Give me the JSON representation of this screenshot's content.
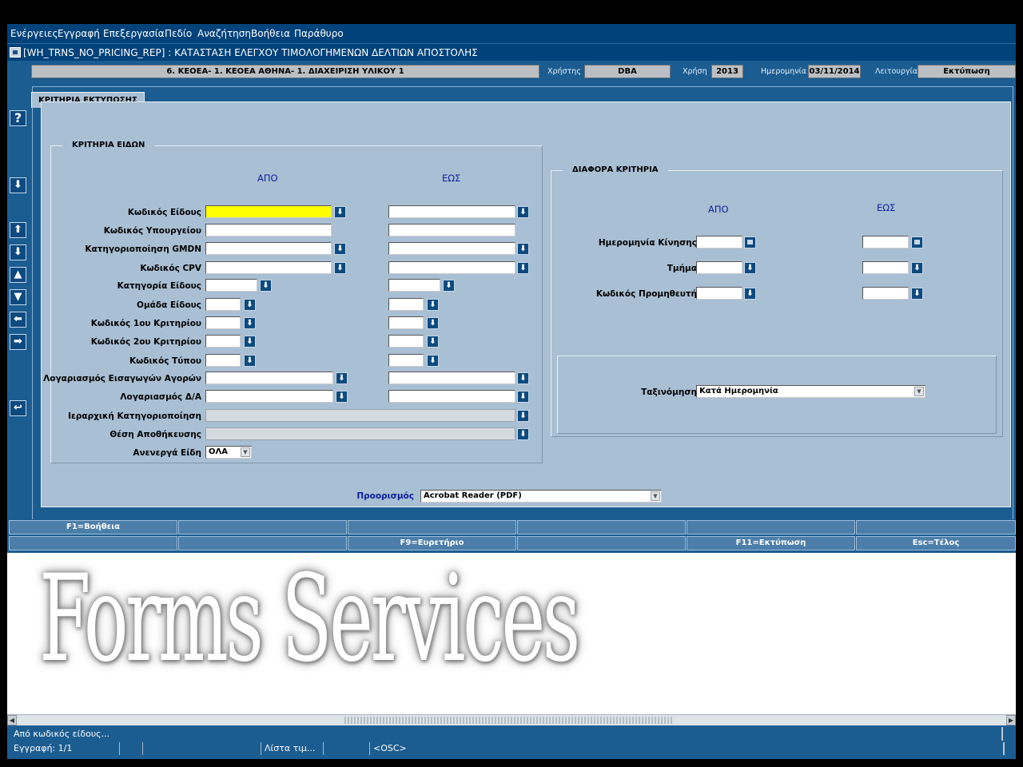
{
  "menubar": [
    "Ενέργειες",
    "Εγγραφή",
    "Επεξεργασία",
    "Πεδίο",
    "Αναζήτηση",
    "Βοήθεια",
    "Παράθυρο"
  ],
  "window": {
    "title": "[WH_TRNS_NO_PRICING_REP]  :  ΚΑΤΑΣΤΑΣΗ ΕΛΕΓΧΟΥ ΤΙΜΟΛΟΓΗΜΕΝΩΝ ΔΕΛΤΙΩΝ ΑΠΟΣΤΟΛΗΣ"
  },
  "infobar": {
    "unit": "6. ΚΕΟΕΑ- 1. ΚΕΟΕΑ ΑΘΗΝΑ- 1. ΔΙΑΧΕΙΡΙΣΗ ΥΛΙΚΟΥ 1",
    "user_label": "Χρήστης",
    "user": "DBA",
    "year_label": "Χρήση",
    "year": "2013",
    "date_label": "Ημερομηνία",
    "date": "03/11/2014",
    "function_label": "Λειτουργία",
    "function": "Εκτύπωση"
  },
  "toolbar_icons": [
    "help-icon",
    "arrow-down-icon",
    "arrow-up-icon",
    "arrow-down-icon",
    "triangle-up-icon",
    "triangle-down-icon",
    "arrow-left-icon",
    "arrow-right-icon",
    "return-icon"
  ],
  "tab": {
    "label": "ΚΡΙΤΗΡΙΑ ΕΚΤΥΠΩΣΗΣ"
  },
  "item_criteria": {
    "title": "ΚΡΙΤΗΡΙΑ ΕΙΔΩΝ",
    "from_label": "ΑΠΟ",
    "to_label": "ΕΩΣ",
    "rows": [
      {
        "label": "Κωδικός Είδους",
        "from_value": "",
        "to_value": ""
      },
      {
        "label": "Κωδικός Υπουργείου",
        "from_value": "",
        "to_value": ""
      },
      {
        "label": "Κατηγοριοποίηση GMDN",
        "from_value": "",
        "to_value": ""
      },
      {
        "label": "Κωδικός CPV",
        "from_value": "",
        "to_value": ""
      },
      {
        "label": "Κατηγορία Είδους",
        "from_value": "",
        "to_value": ""
      },
      {
        "label": "Ομάδα Είδους",
        "from_value": "",
        "to_value": ""
      },
      {
        "label": "Κωδικός 1ου Κριτηρίου",
        "from_value": "",
        "to_value": ""
      },
      {
        "label": "Κωδικός 2ου Κριτηρίου",
        "from_value": "",
        "to_value": ""
      },
      {
        "label": "Κωδικός Τύπου",
        "from_value": "",
        "to_value": ""
      },
      {
        "label": "Λογαριασμός Εισαγωγών Αγορών",
        "from_value": "",
        "to_value": ""
      },
      {
        "label": "Λογαριασμός Δ/Α",
        "from_value": "",
        "to_value": ""
      },
      {
        "label": "Ιεραρχική Κατηγοριοποίηση",
        "value": ""
      },
      {
        "label": "Θέση Αποθήκευσης",
        "value": ""
      }
    ],
    "inactive_label": "Ανενεργά Είδη",
    "inactive_value": "ΟΛΑ"
  },
  "other_criteria": {
    "title": "ΔΙΑΦΟΡΑ ΚΡΙΤΗΡΙΑ",
    "from_label": "ΑΠΟ",
    "to_label": "ΕΩΣ",
    "rows": [
      {
        "label": "Ημερομηνία Κίνησης",
        "from_value": "",
        "to_value": ""
      },
      {
        "label": "Τμήμα",
        "from_value": "",
        "to_value": ""
      },
      {
        "label": "Κωδικός Προμηθευτή",
        "from_value": "",
        "to_value": ""
      }
    ],
    "sort_label": "Ταξινόμηση",
    "sort_value": "Κατά Ημερομηνία"
  },
  "destination": {
    "label": "Προορισμός",
    "value": "Acrobat Reader (PDF)"
  },
  "fkeys": {
    "row1": [
      "F1=Βοήθεια",
      "",
      "",
      "",
      "",
      ""
    ],
    "row2": [
      "",
      "",
      "F9=Ευρετήριο",
      "",
      "F11=Εκτύπωση",
      "Esc=Τέλος"
    ]
  },
  "watermark": "Forms Services",
  "status": {
    "message": "Από κωδικός είδους...",
    "record": "Εγγραφή: 1/1",
    "list": "Λίστα τιμ...",
    "osc": "<OSC>"
  },
  "colors": {
    "panel": "#1b5c91",
    "canvas": "#a9bfd3",
    "active_field": "#ffff00",
    "title_bar": "#00427a"
  }
}
